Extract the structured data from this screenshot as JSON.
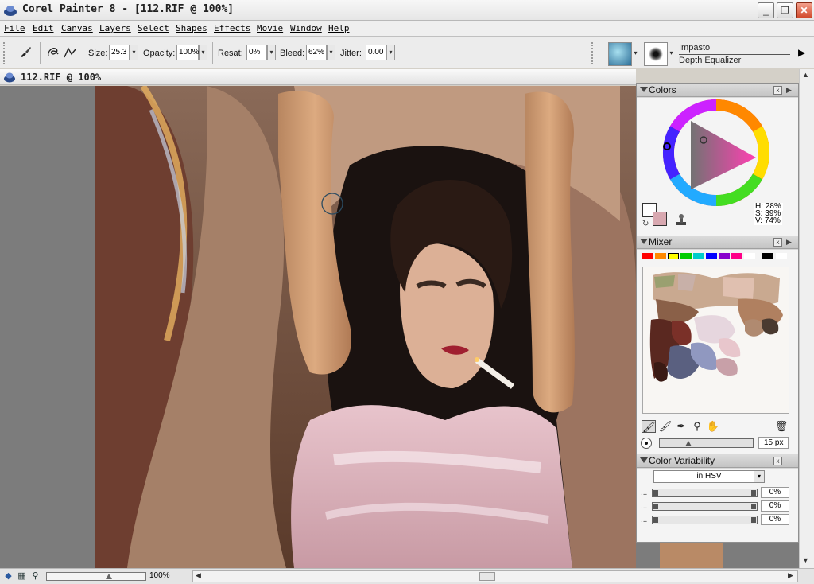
{
  "window": {
    "title": "Corel Painter 8 - [112.RIF @ 100%]",
    "minimize": "_",
    "restore": "❐",
    "close": "✕"
  },
  "menu": [
    "File",
    "Edit",
    "Canvas",
    "Layers",
    "Select",
    "Shapes",
    "Effects",
    "Movie",
    "Window",
    "Help"
  ],
  "property_bar": {
    "size_label": "Size:",
    "size_value": "25.3",
    "opacity_label": "Opacity:",
    "opacity_value": "100%",
    "resat_label": "Resat:",
    "resat_value": "0%",
    "bleed_label": "Bleed:",
    "bleed_value": "62%",
    "jitter_label": "Jitter:",
    "jitter_value": "0.00",
    "brush_category": "Impasto",
    "brush_variant": "Depth Equalizer"
  },
  "document": {
    "title": "112.RIF @ 100%"
  },
  "status_bar": {
    "zoom": "100%"
  },
  "colors_palette": {
    "title": "Colors",
    "h": "H: 28%",
    "s": "S: 39%",
    "v": "V: 74%",
    "main_color": "#ffffff",
    "additional_color": "#d8a8b0"
  },
  "mixer_palette": {
    "title": "Mixer",
    "swatches": [
      "#ff0000",
      "#ff8800",
      "#ffff00",
      "#00cc00",
      "#00cccc",
      "#0000ff",
      "#8800cc",
      "#ff0088",
      "#ffffff",
      "#000000",
      "#ffffff"
    ],
    "brush_size": "15 px"
  },
  "color_variability": {
    "title": "Color Variability",
    "mode": "in HSV",
    "rows": [
      {
        "dots": "...",
        "value": "0%"
      },
      {
        "dots": "...",
        "value": "0%"
      },
      {
        "dots": "...",
        "value": "0%"
      }
    ]
  }
}
